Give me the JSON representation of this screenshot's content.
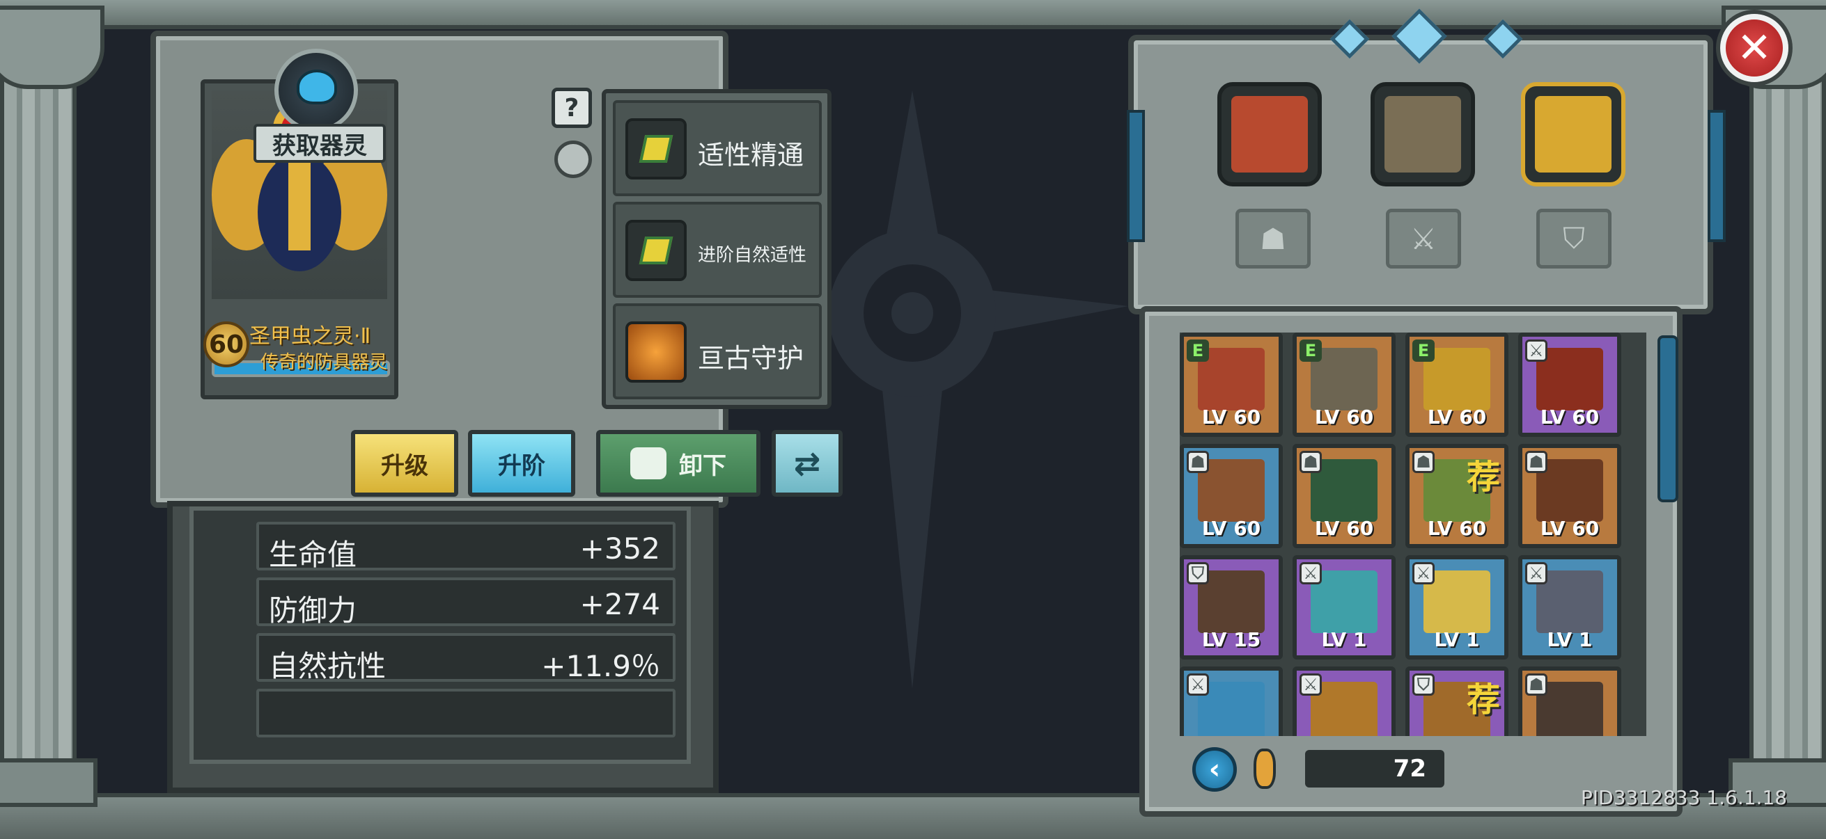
{
  "left_panel": {
    "get_spirit_label": "获取器灵",
    "help_label": "?",
    "card": {
      "level": "60",
      "name": "圣甲虫之灵·Ⅱ",
      "subtitle": "传奇的防具器灵",
      "xp_fraction": 1.0
    },
    "skills": [
      {
        "label": "适性精通",
        "icon": "gem-icon"
      },
      {
        "label": "进阶自然适性",
        "icon": "gem-icon"
      },
      {
        "label": "亘古守护",
        "icon": "scarab-emblem-icon"
      }
    ],
    "buttons": {
      "upgrade": "升级",
      "advance": "升阶",
      "unload": "卸下",
      "swap_icon": "swap-icon"
    },
    "stats": [
      {
        "name": "生命值",
        "value": "+352"
      },
      {
        "name": "防御力",
        "value": "+274"
      },
      {
        "name": "自然抗性",
        "value": "+11.9％"
      },
      {
        "name": "",
        "value": ""
      }
    ]
  },
  "right_top": {
    "close_icon": "close-icon",
    "slots": [
      {
        "name": "red-beast-spirit",
        "color": "#b84a2f"
      },
      {
        "name": "stone-golem-spirit",
        "color": "#7a6e55"
      },
      {
        "name": "scarab-spirit",
        "color": "#d8a830",
        "selected": true
      }
    ],
    "tabs": [
      {
        "icon": "helmet-icon",
        "glyph": "☗"
      },
      {
        "icon": "sword-icon",
        "glyph": "⚔"
      },
      {
        "icon": "shield-icon",
        "glyph": "⛉"
      }
    ]
  },
  "grid": {
    "items": [
      {
        "rarity": "orange",
        "tag": "E",
        "tag_type": "e",
        "lv": "LV 60",
        "art": "#a8442c"
      },
      {
        "rarity": "orange",
        "tag": "E",
        "tag_type": "e",
        "lv": "LV 60",
        "art": "#6d6552"
      },
      {
        "rarity": "orange",
        "tag": "E",
        "tag_type": "e",
        "lv": "LV 60",
        "art": "#c79a2a"
      },
      {
        "rarity": "purple",
        "tag": "⚔",
        "tag_type": "sym",
        "lv": "LV 60",
        "art": "#8b2e1e"
      },
      {
        "rarity": "blue",
        "tag": "☗",
        "tag_type": "sym",
        "lv": "LV 60",
        "art": "#8a5330"
      },
      {
        "rarity": "orange",
        "tag": "☗",
        "tag_type": "sym",
        "lv": "LV 60",
        "art": "#2f5a3c"
      },
      {
        "rarity": "orange",
        "tag": "☗",
        "tag_type": "sym",
        "lv": "LV 60",
        "art": "#6b8a3a",
        "rec": "荐"
      },
      {
        "rarity": "orange",
        "tag": "☗",
        "tag_type": "sym",
        "lv": "LV 60",
        "art": "#6b3a22"
      },
      {
        "rarity": "purple",
        "tag": "⛉",
        "tag_type": "sym",
        "lv": "LV 15",
        "art": "#5a4030"
      },
      {
        "rarity": "purple",
        "tag": "⚔",
        "tag_type": "sym",
        "lv": "LV 1",
        "art": "#3fa0a8"
      },
      {
        "rarity": "blue",
        "tag": "⚔",
        "tag_type": "sym",
        "lv": "LV 1",
        "art": "#d6b94a"
      },
      {
        "rarity": "blue",
        "tag": "⚔",
        "tag_type": "sym",
        "lv": "LV 1",
        "art": "#5a6070"
      },
      {
        "rarity": "blue",
        "tag": "⚔",
        "tag_type": "sym",
        "lv": "",
        "art": "#3a8ab8"
      },
      {
        "rarity": "purple",
        "tag": "⚔",
        "tag_type": "sym",
        "lv": "",
        "art": "#b0782a"
      },
      {
        "rarity": "purple",
        "tag": "⛉",
        "tag_type": "sym",
        "lv": "",
        "art": "#a06a2a",
        "rec": "荐"
      },
      {
        "rarity": "orange",
        "tag": "☗",
        "tag_type": "sym",
        "lv": "",
        "art": "#4a3a30"
      }
    ],
    "back_label": "‹",
    "count": "72"
  },
  "version": "PID3312833 1.6.1.18"
}
